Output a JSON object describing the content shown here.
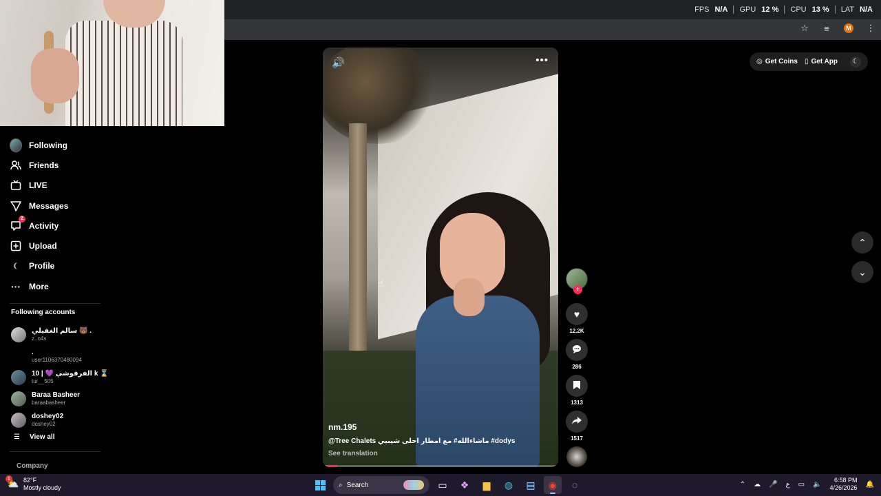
{
  "hud": {
    "fps_label": "FPS",
    "fps_value": "N/A",
    "gpu_label": "GPU",
    "gpu_value": "12 %",
    "cpu_label": "CPU",
    "cpu_value": "13 %",
    "lat_label": "LAT",
    "lat_value": "N/A"
  },
  "browser": {
    "profile_initial": "M"
  },
  "sidebar": {
    "items": [
      {
        "label": "Following",
        "icon": "following-avatar"
      },
      {
        "label": "Friends",
        "icon": "friends-icon"
      },
      {
        "label": "LIVE",
        "icon": "live-icon"
      },
      {
        "label": "Messages",
        "icon": "messages-icon"
      },
      {
        "label": "Activity",
        "icon": "activity-icon",
        "badge": "2"
      },
      {
        "label": "Upload",
        "icon": "upload-icon"
      },
      {
        "label": "Profile",
        "icon": "profile-icon"
      },
      {
        "label": "More",
        "icon": "more-icon"
      }
    ],
    "following_title": "Following accounts",
    "accounts": [
      {
        "name": "سالم الغفيلي 🐻 .",
        "user": "z..n4s"
      },
      {
        "name": ".",
        "user": "user1106370480094"
      },
      {
        "name": "10 | 💜 الفرفوشي k ⌛",
        "user": "tur__505"
      },
      {
        "name": "Baraa Basheer",
        "user": "baraabasheer"
      },
      {
        "name": "doshey02",
        "user": "doshey02"
      }
    ],
    "view_all": "View all",
    "company": "Company"
  },
  "video": {
    "author": "nm.195",
    "caption": "@Tree Chalets ماشاءالله# مع امطار احلى شيبيي #dodys",
    "see_translation": "See translation",
    "progress": 0.06
  },
  "actions": {
    "likes": "12.2K",
    "comments": "286",
    "saves": "1313",
    "shares": "1517"
  },
  "top_actions": {
    "get_coins": "Get Coins",
    "get_app": "Get App"
  },
  "taskbar": {
    "temperature": "82°F",
    "weather": "Mostly cloudy",
    "weather_badge": "1",
    "search": "Search",
    "lang": "ع",
    "time": "6:58 PM",
    "date": "4/26/2026"
  }
}
